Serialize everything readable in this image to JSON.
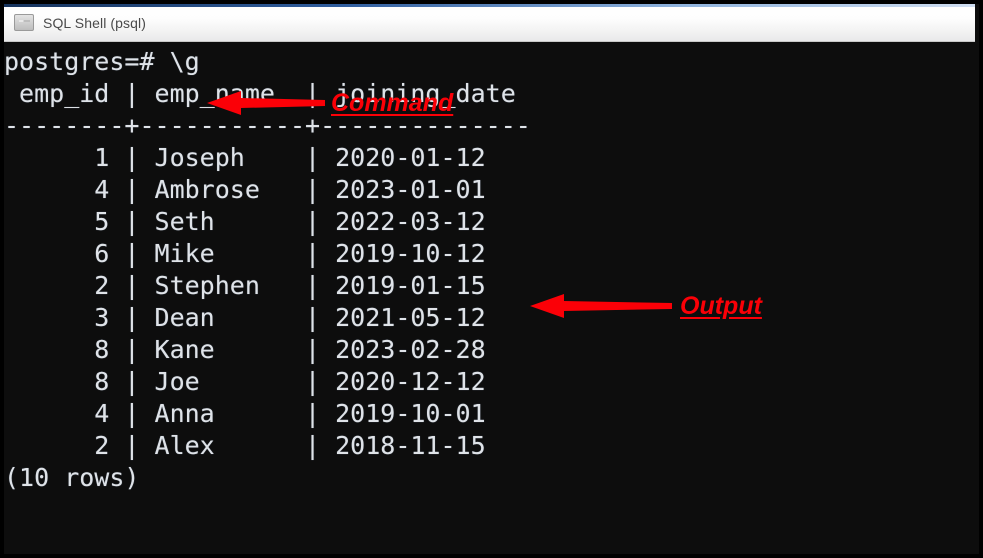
{
  "window": {
    "title": "SQL Shell (psql)",
    "icon": "console-icon",
    "background_color": "#0d0d0d",
    "text_color": "#dfe3e8"
  },
  "terminal": {
    "prompt": "postgres=#",
    "command": "\\g",
    "prompt_line": "postgres=# \\g",
    "columns": [
      "emp_id",
      "emp_name",
      "joining_date"
    ],
    "header_line": " emp_id | emp_name  | joining_date",
    "separator_line": "--------+-----------+--------------",
    "rows": [
      {
        "emp_id": "1",
        "emp_name": "Joseph",
        "joining_date": "2020-01-12"
      },
      {
        "emp_id": "4",
        "emp_name": "Ambrose",
        "joining_date": "2023-01-01"
      },
      {
        "emp_id": "5",
        "emp_name": "Seth",
        "joining_date": "2022-03-12"
      },
      {
        "emp_id": "6",
        "emp_name": "Mike",
        "joining_date": "2019-10-12"
      },
      {
        "emp_id": "2",
        "emp_name": "Stephen",
        "joining_date": "2019-01-15"
      },
      {
        "emp_id": "3",
        "emp_name": "Dean",
        "joining_date": "2021-05-12"
      },
      {
        "emp_id": "8",
        "emp_name": "Kane",
        "joining_date": "2023-02-28"
      },
      {
        "emp_id": "8",
        "emp_name": "Joe",
        "joining_date": "2020-12-12"
      },
      {
        "emp_id": "4",
        "emp_name": "Anna",
        "joining_date": "2019-10-01"
      },
      {
        "emp_id": "2",
        "emp_name": "Alex",
        "joining_date": "2018-11-15"
      }
    ],
    "row_count_text": "(10 rows)",
    "screen_text": "postgres=# \\g\n emp_id | emp_name  | joining_date\n--------+-----------+--------------\n      1 | Joseph    | 2020-01-12\n      4 | Ambrose   | 2023-01-01\n      5 | Seth      | 2022-03-12\n      6 | Mike      | 2019-10-12\n      2 | Stephen   | 2019-01-15\n      3 | Dean      | 2021-05-12\n      8 | Kane      | 2023-02-28\n      8 | Joe       | 2020-12-12\n      4 | Anna      | 2019-10-01\n      2 | Alex      | 2018-11-15\n(10 rows)"
  },
  "annotations": {
    "color": "#fb0007",
    "command": {
      "label": "Command",
      "arrow_direction": "left"
    },
    "output": {
      "label": "Output",
      "arrow_direction": "left"
    }
  }
}
